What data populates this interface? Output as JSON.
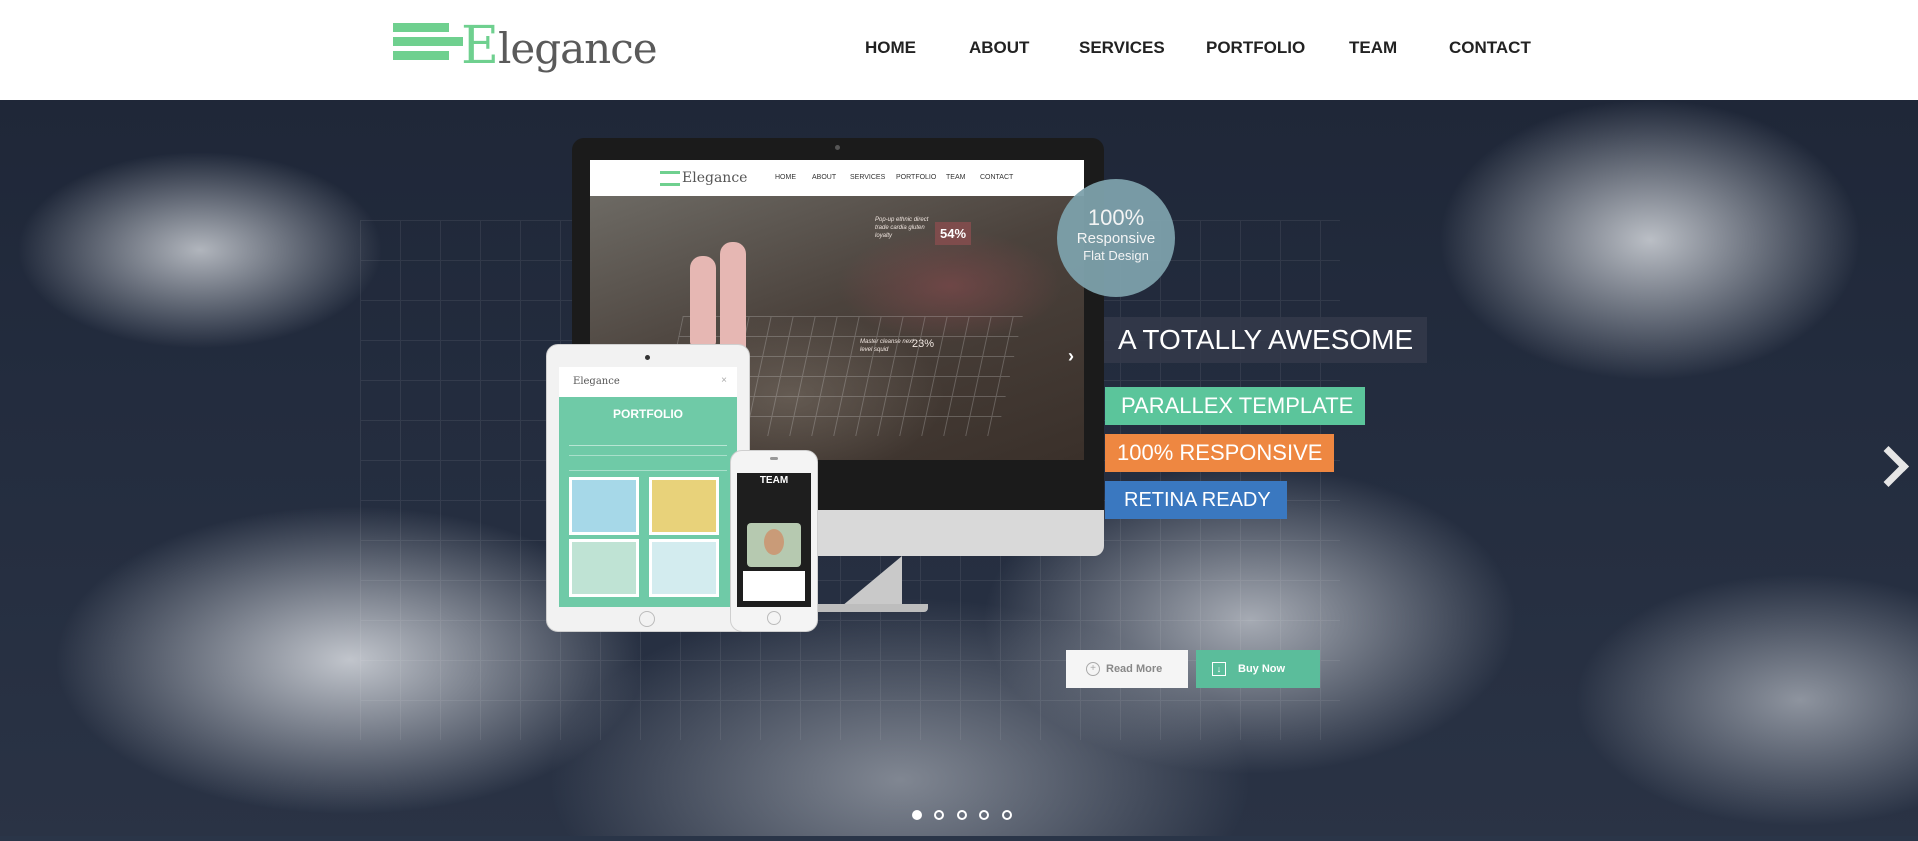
{
  "brand": {
    "name_first": "E",
    "name_rest": "legance",
    "accent": "#6fd08f"
  },
  "nav": {
    "items": [
      {
        "label": "HOME"
      },
      {
        "label": "ABOUT"
      },
      {
        "label": "SERVICES"
      },
      {
        "label": "PORTFOLIO"
      },
      {
        "label": "TEAM"
      },
      {
        "label": "CONTACT"
      }
    ]
  },
  "hero": {
    "badge": {
      "line1": "100%",
      "line2": "Responsive",
      "line3": "Flat Design",
      "color": "#7da1ab"
    },
    "tags": [
      {
        "label": "A TOTALLY AWESOME",
        "color": "#343a4a"
      },
      {
        "label": "PARALLEX TEMPLATE",
        "color": "#5bc59b"
      },
      {
        "label": "100% RESPONSIVE",
        "color": "#ee8741"
      },
      {
        "label": "RETINA READY",
        "color": "#3a78c0"
      }
    ],
    "buttons": {
      "read_more": "Read More",
      "buy_now": "Buy Now"
    },
    "slider": {
      "dot_count": 5,
      "active_index": 0,
      "next_icon": "chevron-right-icon"
    }
  },
  "mockup": {
    "monitor_nav": [
      "HOME",
      "ABOUT",
      "SERVICES",
      "PORTFOLIO",
      "TEAM",
      "CONTACT"
    ],
    "stat_a": "54%",
    "stat_b": "23%",
    "tablet_title": "PORTFOLIO",
    "phone_title": "TEAM"
  }
}
